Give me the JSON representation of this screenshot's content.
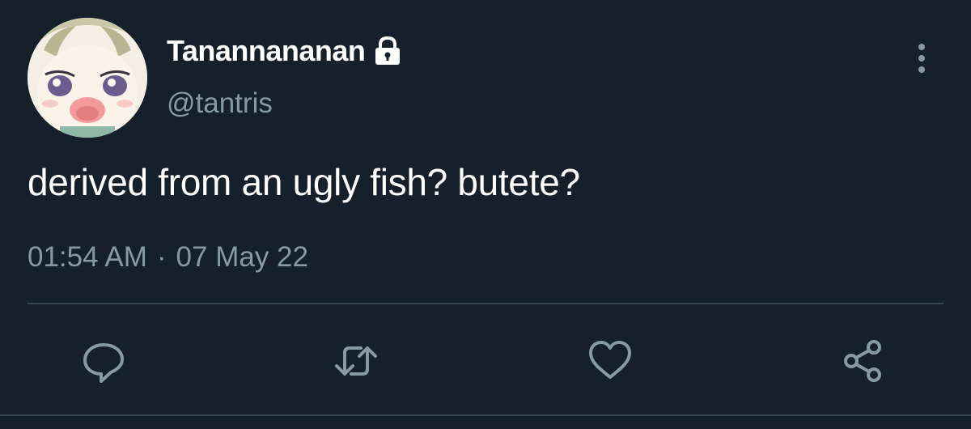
{
  "user": {
    "display_name": "Tanannananan",
    "handle": "@tantris",
    "protected_icon": "lock-icon",
    "avatar": "anime-face-avatar"
  },
  "tweet": {
    "text": "derived from an ugly fish? butete?",
    "time": "01:54 AM",
    "separator": "·",
    "date": "07 May 22"
  },
  "actions": {
    "more": "more-vertical-icon",
    "reply": "reply-icon",
    "retweet": "retweet-icon",
    "like": "heart-icon",
    "share": "share-icon"
  },
  "colors": {
    "background": "#15202b",
    "text_primary": "#ffffff",
    "text_secondary": "#8899a6",
    "divider": "#38444d"
  }
}
